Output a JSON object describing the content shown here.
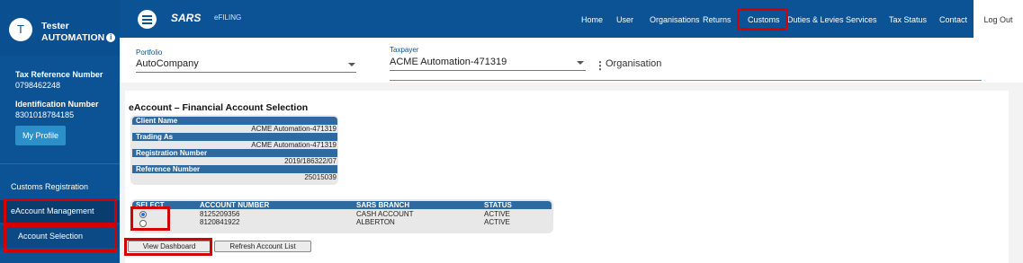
{
  "user": {
    "initial": "T",
    "first_name": "Tester",
    "last_name": "AUTOMATION",
    "info_glyph": "i",
    "tax_ref_label": "Tax Reference Number",
    "tax_ref_value": "0798462248",
    "id_label": "Identification Number",
    "id_value": "8301018784185",
    "profile_button": "My Profile"
  },
  "sidebar": {
    "items": [
      {
        "label": "Customs Registration"
      },
      {
        "label": "eAccount Management"
      },
      {
        "label": "Account Selection"
      }
    ]
  },
  "header": {
    "logo_text": "SARS",
    "efiling_text": "eFILING",
    "nav": [
      "Home",
      "User",
      "Organisations",
      "Returns",
      "Customs",
      "Duties & Levies",
      "Services",
      "Tax Status",
      "Contact"
    ],
    "logout": "Log Out"
  },
  "selectors": {
    "portfolio_label": "Portfolio",
    "portfolio_value": "AutoCompany",
    "taxpayer_label": "Taxpayer",
    "taxpayer_value": "ACME Automation-471319",
    "organisation_text": "Organisation"
  },
  "page": {
    "title": "eAccount – Financial Account Selection"
  },
  "client": {
    "name_label": "Client Name",
    "name_value": "ACME Automation-471319",
    "trading_label": "Trading As",
    "trading_value": "ACME Automation-471319",
    "reg_label": "Registration Number",
    "reg_value": "2019/186322/07",
    "ref_label": "Reference Number",
    "ref_value": "25015039"
  },
  "accounts": {
    "columns": [
      "SELECT",
      "ACCOUNT NUMBER",
      "SARS BRANCH",
      "STATUS"
    ],
    "rows": [
      {
        "selected": true,
        "number": "8125209356",
        "branch": "CASH ACCOUNT",
        "status": "ACTIVE"
      },
      {
        "selected": false,
        "number": "8120841922",
        "branch": "ALBERTON",
        "status": "ACTIVE"
      }
    ]
  },
  "buttons": {
    "view_dashboard": "View Dashboard",
    "refresh": "Refresh Account List"
  },
  "colors": {
    "primary": "#0b5394",
    "highlight": "#d40000",
    "table_header": "#2e6aa0"
  }
}
